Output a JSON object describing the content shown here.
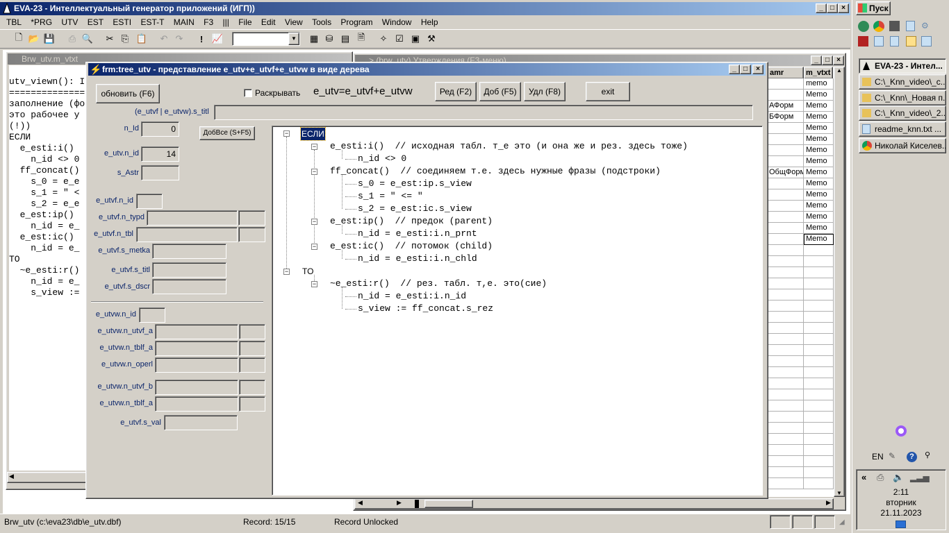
{
  "app": {
    "title": "EVA-23 - Интеллектуальный генератор приложений (ИГП))",
    "menu": [
      "TBL",
      "*PRG",
      "UTV",
      "EST",
      "ESTI",
      "EST-T",
      "MAIN",
      "F3",
      "|||",
      "File",
      "Edit",
      "View",
      "Tools",
      "Program",
      "Window",
      "Help"
    ]
  },
  "editor": {
    "title": "Brw_utv.m_vtxt",
    "lines": [
      "utv_viewn(): I",
      "==============",
      "",
      "заполнение (фо",
      "",
      "это рабочее у",
      "(!))",
      "",
      "ЕСЛИ",
      "  e_esti:i()",
      "    n_id <> 0",
      "  ff_concat()",
      "    s_0 = e_e",
      "    s_1 = \" <",
      "    s_2 = e_e",
      "  e_est:ip()",
      "    n_id = e_",
      "  e_est:ic()",
      "    n_id = e_",
      "TO",
      "  ~e_esti:r()",
      "    n_id = e_",
      "    s_view :="
    ]
  },
  "grid_window": {
    "title": "> (brw_utv) Утверждения (F3-меню)",
    "col_amr": "amr",
    "col_vtxt": "m_vtxt",
    "amr_values": [
      "",
      "",
      "АФорм",
      "БФорм",
      "",
      "",
      "",
      "",
      "ОбщФорм",
      "",
      "",
      "",
      "",
      "",
      ""
    ],
    "vtxt_values": [
      "memo",
      "Memo",
      "Memo",
      "Memo",
      "Memo",
      "Memo",
      "Memo",
      "Memo",
      "Memo",
      "Memo",
      "Memo",
      "Memo",
      "Memo",
      "Memo",
      "Memo"
    ]
  },
  "dialog": {
    "title": "frm:tree_utv - представление e_utv+e_utvf+e_utvw в виде дерева",
    "refresh_button": "обновить (F6)",
    "expand_checkbox": "Раскрывать",
    "formula": "e_utv=e_utvf+e_utvw",
    "edit_button": "Ред (F2)",
    "add_button": "Доб (F5)",
    "delete_button": "Удл (F8)",
    "exit_button": "exit",
    "s_titl_label": "(e_utvf | e_utvw).s_titl",
    "s_titl_value": "",
    "n_id_label": "n_Id",
    "n_id_value": "0",
    "addall_button": "ДобВсе (S+F5)",
    "utv_n_id_label": "e_utv.n_id",
    "utv_n_id_value": "14",
    "s_astr_label": "s_Astr",
    "utvf_n_id_label": "e_utvf.n_id",
    "utvf_n_typd_label": "e_utvf.n_typd",
    "utvf_n_tbl_label": "e_utvf.n_tbl",
    "utvf_s_metka_label": "e_utvf.s_metka",
    "utvf_s_titl_label": "e_utvf.s_titl",
    "utvf_s_dscr_label": "e_utvf.s_dscr",
    "utvw_n_id_label": "e_utvw.n_id",
    "utvw_n_utvf_a_label": "e_utvw.n_utvf_a",
    "utvw_n_tblf_a_label": "e_utvw.n_tblf_a",
    "utvw_n_operl_label": "e_utvw.n_operl",
    "utvw_n_utvf_b_label": "e_utvw.n_utvf_b",
    "utvw_n_tblf_a2_label": "e_utvw.n_tblf_a",
    "utvf_s_val_label": "e_utvf.s_val"
  },
  "tree": {
    "root_if": "ЕСЛИ",
    "n1": "e_esti:i()  // исходная табл. т_е это (и она же и рез. здесь тоже)",
    "n1a": "n_id <> 0",
    "n2": "ff_concat()  // соединяем т.е. здесь нужные фразы (подстроки)",
    "n2a": "s_0 = e_est:ip.s_view",
    "n2b": "s_1 = \" <= \"",
    "n2c": "s_2 = e_est:ic.s_view",
    "n3": "e_est:ip()  // предок (parent)",
    "n3a": "n_id = e_esti:i.n_prnt",
    "n4": "e_est:ic()  // потомок (child)",
    "n4a": "n_id = e_esti:i.n_chld",
    "root_then": "TO",
    "n5": "~e_esti:r()  // рез. табл. т,е. это(сие)",
    "n5a": "n_id = e_esti:i.n_id",
    "n5b": "s_view := ff_concat.s_rez"
  },
  "status": {
    "path": "Brw_utv (c:\\eva23\\db\\e_utv.dbf)",
    "record": "Record: 15/15",
    "lock": "Record Unlocked"
  },
  "taskbar": {
    "start": "Пуск",
    "items": [
      "EVA-23 - Интел...",
      "C:\\_Knn_video\\_c...",
      "C:\\_Knn\\_Новая п...",
      "C:\\_Knn_video\\_2...",
      "readme_knn.txt ...",
      "Николай Киселев..."
    ],
    "lang": "EN",
    "time": "2:11",
    "weekday": "вторник",
    "date": "21.11.2023"
  },
  "colors": {
    "title_active": "#0a246a",
    "selection": "#0a246a",
    "label_blue": "#0a246a"
  }
}
